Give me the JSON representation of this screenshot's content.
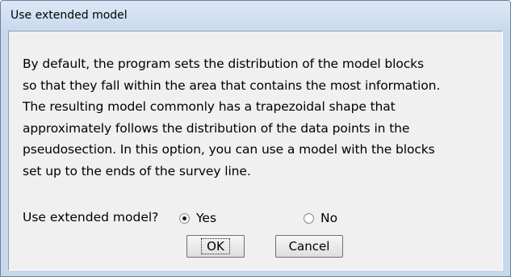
{
  "window": {
    "title": "Use extended model"
  },
  "message": {
    "lines": [
      "By default, the program sets the distribution of the model blocks",
      "so that they fall within the area that contains the most information.",
      "The resulting model commonly has a trapezoidal shape that",
      "approximately follows the distribution of the data points in the",
      "pseudosection. In this option, you can use a model with the blocks",
      "set up to the ends of the survey line."
    ]
  },
  "question": {
    "label": "Use extended model?",
    "options": [
      {
        "label": "Yes",
        "selected": true
      },
      {
        "label": "No",
        "selected": false
      }
    ]
  },
  "buttons": {
    "ok_label": "OK",
    "cancel_label": "Cancel"
  },
  "colors": {
    "frame": "#c7d7ec",
    "client": "#f0f0f0"
  }
}
